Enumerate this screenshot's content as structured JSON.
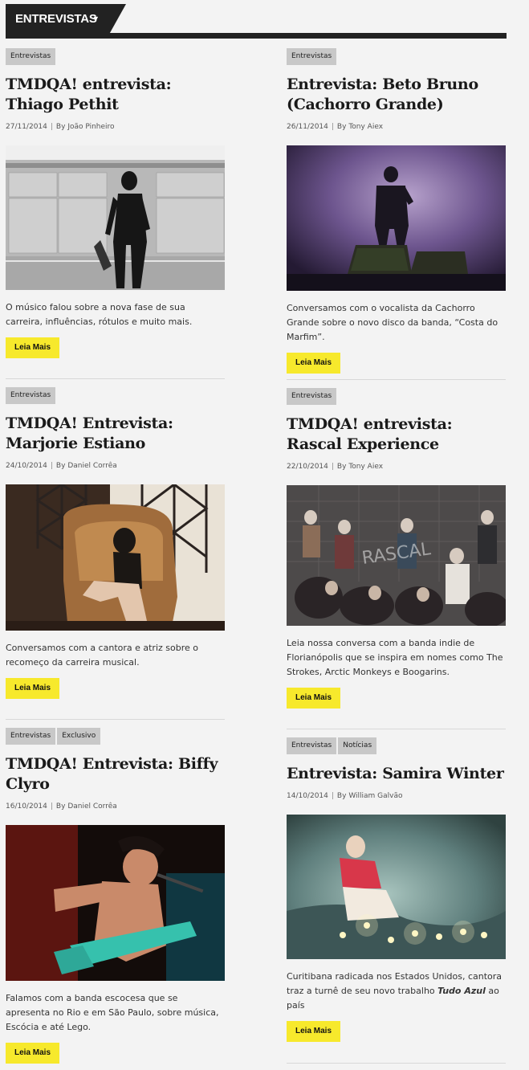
{
  "section": {
    "title": "ENTREVISTAS"
  },
  "read_more_label": "Leia Mais",
  "by_prefix": "By",
  "posts": [
    {
      "tags": [
        "Entrevistas"
      ],
      "title": "TMDQA! entrevista: Thiago Pethit",
      "date": "27/11/2014",
      "author": "João Pinheiro",
      "excerpt": "O músico falou sobre a nova fase de sua carreira, influências, rótulos e muito mais."
    },
    {
      "tags": [
        "Entrevistas"
      ],
      "title": "Entrevista: Beto Bruno (Cachorro Grande)",
      "date": "26/11/2014",
      "author": "Tony Aiex",
      "excerpt": "Conversamos com o vocalista da Cachorro Grande sobre o novo disco da banda, “Costa do Marfim”."
    },
    {
      "tags": [
        "Entrevistas"
      ],
      "title": "TMDQA! Entrevista: Marjorie Estiano",
      "date": "24/10/2014",
      "author": "Daniel Corrêa",
      "excerpt": "Conversamos com a cantora e atriz sobre o recomeço da carreira musical."
    },
    {
      "tags": [
        "Entrevistas"
      ],
      "title": "TMDQA! entrevista: Rascal Experience",
      "date": "22/10/2014",
      "author": "Tony Aiex",
      "excerpt": "Leia nossa conversa com a banda indie de Florianópolis que se inspira em nomes como The Strokes, Arctic Monkeys e Boogarins."
    },
    {
      "tags": [
        "Entrevistas",
        "Exclusivo"
      ],
      "title": "TMDQA! Entrevista: Biffy Clyro",
      "date": "16/10/2014",
      "author": "Daniel Corrêa",
      "excerpt": "Falamos com a banda escocesa que se apresenta no Rio e em São Paulo, sobre música, Escócia e até Lego."
    },
    {
      "tags": [
        "Entrevistas",
        "Notícias"
      ],
      "title": "Entrevista: Samira Winter",
      "date": "14/10/2014",
      "author": "William Galvão",
      "excerpt_before": "Curitibana radicada nos Estados Unidos, cantora traz a turnê de seu novo trabalho ",
      "excerpt_em": "Tudo Azul",
      "excerpt_after": " ao país"
    }
  ]
}
